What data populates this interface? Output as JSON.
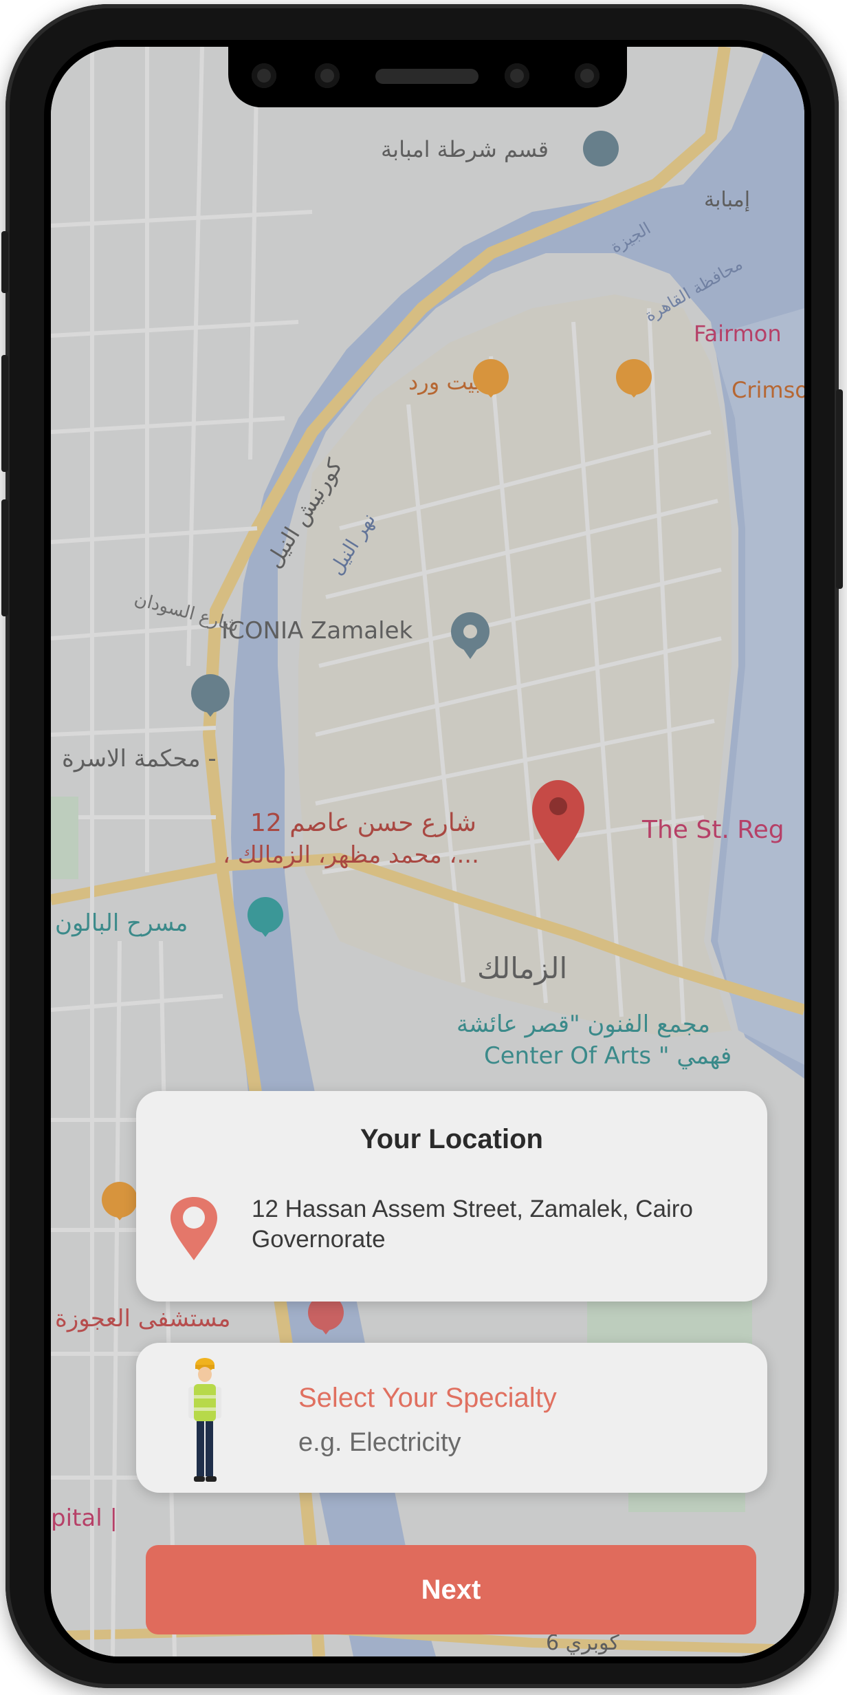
{
  "map": {
    "labels": {
      "police": "قسم شرطة امبابة",
      "imbaba": "إمبابة",
      "giza": "الجيزة",
      "cairo_gov": "محافظة القاهرة",
      "fairmont": "Fairmon",
      "crimson": "Crimso",
      "beit_ward": "بيت ورد",
      "corniche": "كورنيش النيل",
      "nile": "نهر النيل",
      "iconia": "ICONIA Zamalek",
      "court": "محكمة الاسرة -",
      "street_sudan": "شارع السودان",
      "address_ar_1": "12 شارع حسن عاصم",
      "address_ar_2": "، محمد مظهر، الزمالك ،...",
      "st_regis": "The St. Reg",
      "balloon": "مسرح البالون",
      "zamalek": "الزمالك",
      "arts_ar": "مجمع الفنون \"قصر عائشة",
      "arts_en": "Center Of Arts \" فهمي",
      "hospital": "مستشفى العجوزة",
      "hospital_en": "pital |",
      "bottom_bridge": "كوبري 6"
    }
  },
  "location_card": {
    "title": "Your Location",
    "address": "12 Hassan Assem Street, Zamalek, Cairo Governorate"
  },
  "specialty_card": {
    "title": "Select Your Specialty",
    "hint": "e.g. Electricity"
  },
  "next_button": {
    "label": "Next"
  },
  "colors": {
    "accent": "#e06b5c",
    "card_bg": "#efefef"
  }
}
